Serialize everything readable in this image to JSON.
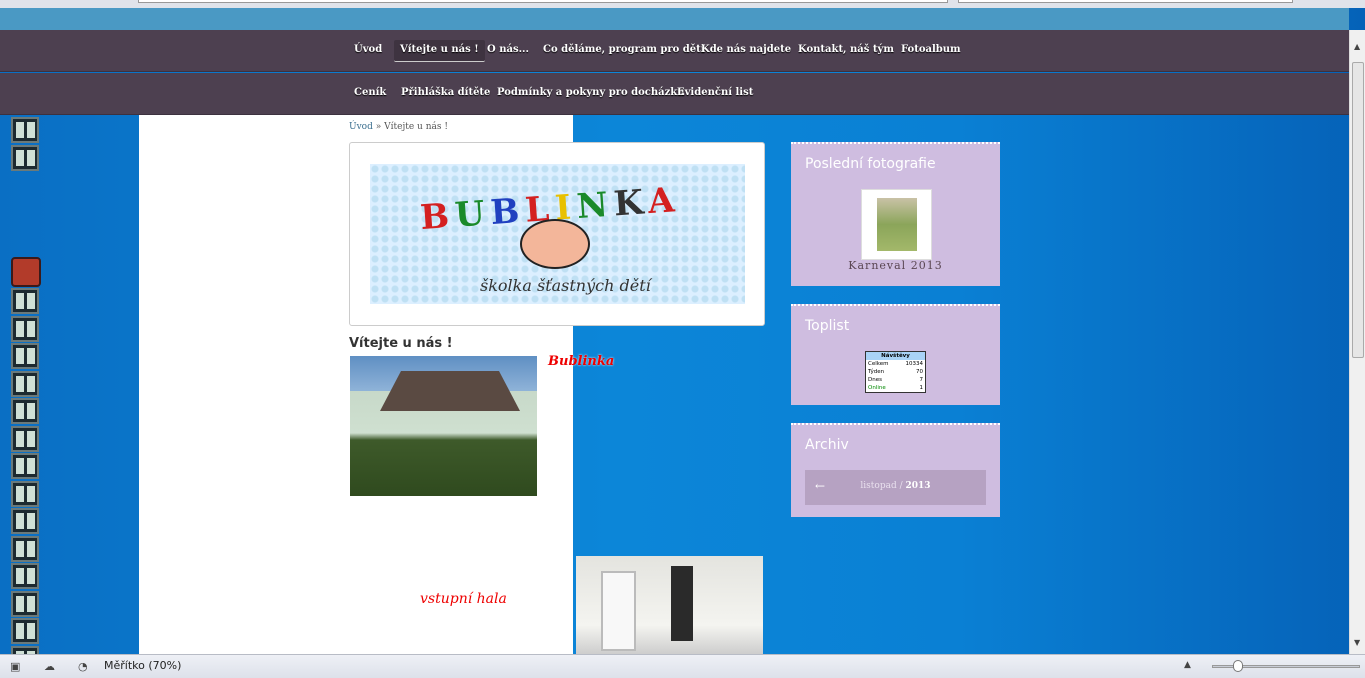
{
  "nav": {
    "row1": [
      "Úvod",
      "Vítejte u nás !",
      "O nás...",
      "Co děláme, program pro děti",
      "Kde nás najdete",
      "Kontakt, náš tým",
      "Fotoalbum"
    ],
    "row2": [
      "Ceník",
      "Přihláška dítěte",
      "Podmínky a pokyny pro docházku",
      "Evidenční list"
    ],
    "active": "Vítejte u nás !"
  },
  "breadcrumb": {
    "home": "Úvod",
    "sep": "»",
    "current": "Vítejte u nás !"
  },
  "logo": {
    "title": "BUBLINKA",
    "subtitle": "školka šťastných dětí"
  },
  "page": {
    "title": "Vítejte u nás !",
    "caption1": "Bublinka",
    "caption2": "vstupní hala"
  },
  "sidebar": {
    "photos": {
      "title": "Poslední fotografie",
      "caption": "Karneval 2013"
    },
    "toplist": {
      "title": "Toplist",
      "header": "Návštěvy",
      "rows": [
        {
          "label": "Celkem",
          "value": "10334"
        },
        {
          "label": "Týden",
          "value": "70"
        },
        {
          "label": "Dnes",
          "value": "7"
        },
        {
          "label": "Online",
          "value": "1"
        }
      ]
    },
    "archive": {
      "title": "Archiv",
      "arrow": "←",
      "month": "listopad",
      "sep": "/",
      "year": "2013"
    }
  },
  "statusbar": {
    "zoom": "Měřítko (70%)",
    "zoom_level": 0.7
  }
}
